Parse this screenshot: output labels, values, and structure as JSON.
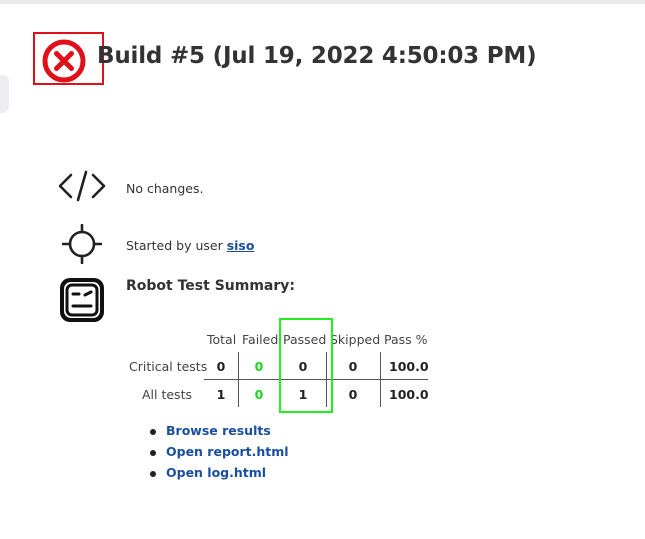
{
  "build": {
    "title": "Build #5 (Jul 19, 2022 4:50:03 PM)",
    "status_icon": "circle-x-icon",
    "status_color": "#e0101b"
  },
  "changes": {
    "icon": "code-icon",
    "text": "No changes."
  },
  "cause": {
    "icon": "crosshair-icon",
    "prefix": "Started by user ",
    "user": "siso"
  },
  "robot": {
    "icon": "robot-face-icon",
    "title": "Robot Test Summary:",
    "columns": [
      "Total",
      "Failed",
      "Passed",
      "Skipped",
      "Pass %"
    ],
    "rows": [
      {
        "label": "Critical tests",
        "total": "0",
        "failed": "0",
        "passed": "0",
        "skipped": "0",
        "pass_pct": "100.0"
      },
      {
        "label": "All tests",
        "total": "1",
        "failed": "0",
        "passed": "1",
        "skipped": "0",
        "pass_pct": "100.0"
      }
    ],
    "failed_color": "#19d919",
    "highlight_color": "#22ee22"
  },
  "links": [
    {
      "label": "Browse results"
    },
    {
      "label": "Open report.html"
    },
    {
      "label": "Open log.html"
    }
  ],
  "link_color": "#1a4fa0"
}
